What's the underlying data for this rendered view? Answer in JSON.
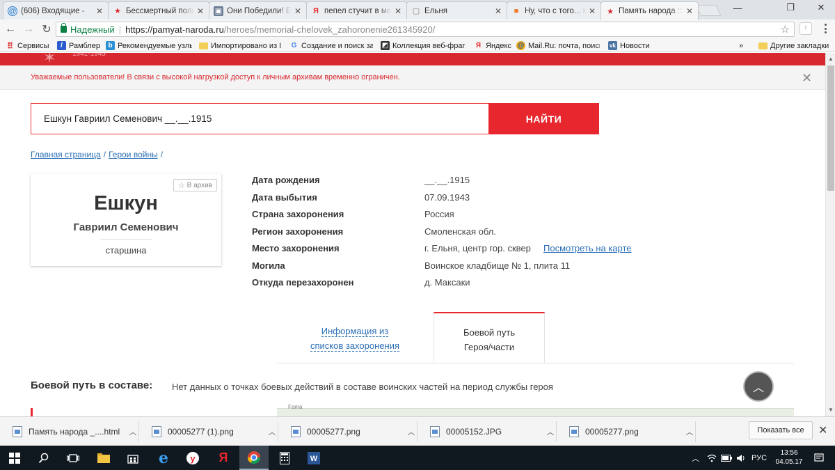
{
  "tabs": [
    {
      "title": "(606) Входящие - ",
      "favicon_text": "@",
      "favicon_color": "#2a7fd0"
    },
    {
      "title": "Бессмертный полк",
      "favicon_text": "★",
      "favicon_color": "#d8282f"
    },
    {
      "title": "Они Победили! Ел",
      "favicon_text": "▣",
      "favicon_color": "#6a7d95"
    },
    {
      "title": "пепел стучит в мо",
      "favicon_text": "Я",
      "favicon_color": "#e8262d"
    },
    {
      "title": "Ельня",
      "favicon_text": "▢",
      "favicon_color": "#888888"
    },
    {
      "title": "Ну, что с того... Ю",
      "favicon_text": "■",
      "favicon_color": "#f07a2c"
    },
    {
      "title": "Память народа :: Д",
      "favicon_text": "★",
      "favicon_color": "#d8282f"
    }
  ],
  "window_controls": {
    "minimize": "—",
    "restore": "❐",
    "close": "✕"
  },
  "address_bar": {
    "secure_label": "Надежный",
    "separator": "|",
    "url_host": "https://pamyat-naroda.ru",
    "url_path": "/heroes/memorial-chelovek_zahoronenie261345920/"
  },
  "bookmarks": [
    {
      "label": "Сервисы",
      "icon": "apps-grid-icon"
    },
    {
      "label": "Рамблер",
      "icon": "rambler-icon"
    },
    {
      "label": "Рекомендуемые узлы",
      "icon": "bing-icon"
    },
    {
      "label": "Импортировано из IE",
      "icon": "folder-icon"
    },
    {
      "label": "Создание и поиск за",
      "icon": "google-icon"
    },
    {
      "label": "Коллекция веб-фраг",
      "icon": "webslice-icon"
    },
    {
      "label": "Яндекс",
      "icon": "yandex-icon"
    },
    {
      "label": "Mail.Ru: почта, поиск",
      "icon": "mailru-icon"
    },
    {
      "label": "Новости",
      "icon": "vk-icon"
    }
  ],
  "bookmarks_overflow": "»",
  "other_bookmarks": "Другие закладки",
  "header_logo_text": "1941-1945",
  "notice": "Уважаемые пользователи! В связи с высокой нагрузкой доступ к личным архивам временно ограничен.",
  "search": {
    "value": "Ешкун Гавриил Семенович __.__.1915",
    "button": "НАЙТИ"
  },
  "breadcrumbs": [
    {
      "label": "Главная страница"
    },
    {
      "label": "Герои войны"
    }
  ],
  "breadcrumb_separator": "/",
  "hero": {
    "archive_button": "В архив",
    "surname": "Ешкун",
    "given_names": "Гавриил Семенович",
    "rank": "старшина"
  },
  "details": [
    {
      "label": "Дата рождения",
      "value": "__.__.1915"
    },
    {
      "label": "Дата выбытия",
      "value": "07.09.1943"
    },
    {
      "label": "Страна захоронения",
      "value": "Россия"
    },
    {
      "label": "Регион захоронения",
      "value": "Смоленская обл."
    },
    {
      "label": "Место захоронения",
      "value": "г. Ельня, центр гор. сквер",
      "link": "Посмотреть на карте"
    },
    {
      "label": "Могила",
      "value": "Воинское кладбище № 1, плита 11"
    },
    {
      "label": "Откуда перезахоронен",
      "value": "д. Максаки"
    }
  ],
  "info_tabs": {
    "burial_lists": [
      "Информация из",
      "списков захоронения"
    ],
    "combat_path": [
      "Боевой путь",
      "Героя/части"
    ]
  },
  "combat": {
    "label": "Боевой путь в составе:",
    "text": "Нет данных о точках боевых действий в составе воинских частей на период службы героя"
  },
  "map_fragment_text": "Fama",
  "downloads": [
    {
      "name": "Память народа _....html"
    },
    {
      "name": "00005277 (1).png"
    },
    {
      "name": "00005277.png"
    },
    {
      "name": "00005152.JPG"
    },
    {
      "name": "00005277.png"
    }
  ],
  "downloads_show_all": "Показать все",
  "taskbar": {
    "language": "РУС",
    "time": "13:56",
    "date": "04.05.17"
  },
  "colors": {
    "brand_red": "#e8262d",
    "link_blue": "#2a6fb5",
    "secure_green": "#0b8043"
  }
}
